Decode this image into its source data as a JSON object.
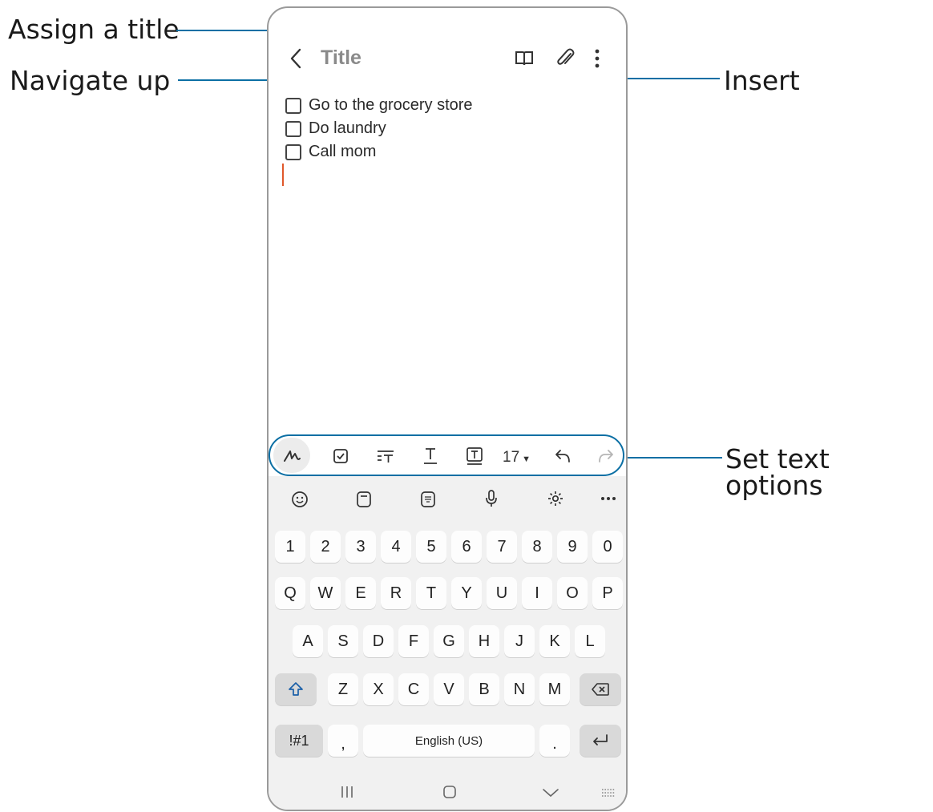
{
  "callouts": {
    "assign_title": "Assign a title",
    "navigate_up": "Navigate up",
    "insert": "Insert",
    "text_options": "Set text options"
  },
  "note": {
    "title_placeholder": "Title",
    "checklist": [
      "Go to the grocery store",
      "Do laundry",
      "Call mom"
    ]
  },
  "text_toolbar": {
    "font_size": "17",
    "icons": [
      "handwriting-icon",
      "checkbox-icon",
      "paragraph-style-icon",
      "text-style-icon",
      "text-box-icon",
      "font-size-dropdown",
      "undo-icon",
      "redo-icon"
    ]
  },
  "keyboard": {
    "toolbar_icons": [
      "emoji-icon",
      "clipboard-icon",
      "sticker-icon",
      "microphone-icon",
      "settings-icon",
      "more-icon"
    ],
    "rows": [
      [
        "1",
        "2",
        "3",
        "4",
        "5",
        "6",
        "7",
        "8",
        "9",
        "0"
      ],
      [
        "Q",
        "W",
        "E",
        "R",
        "T",
        "Y",
        "U",
        "I",
        "O",
        "P"
      ],
      [
        "A",
        "S",
        "D",
        "F",
        "G",
        "H",
        "J",
        "K",
        "L"
      ],
      [
        "Z",
        "X",
        "C",
        "V",
        "B",
        "N",
        "M"
      ]
    ],
    "symbols_key": "!#1",
    "comma_key": ",",
    "space_label": "English (US)",
    "period_key": "."
  },
  "colors": {
    "callout_line": "#0b6fa4",
    "cursor": "#e0582b",
    "keyboard_bg": "#f1f1f1"
  }
}
